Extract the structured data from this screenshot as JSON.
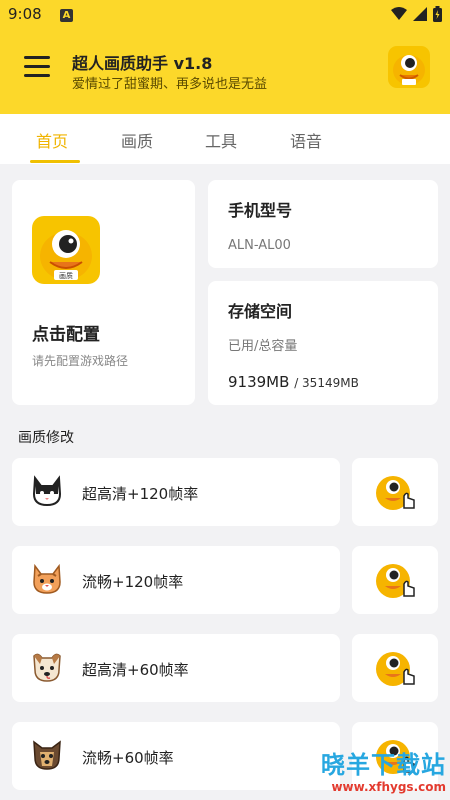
{
  "status": {
    "time": "9:08",
    "badge": "A"
  },
  "header": {
    "title": "超人画质助手 v1.8",
    "subtitle": "爱情过了甜蜜期、再多说也是无益"
  },
  "tabs": [
    {
      "label": "首页",
      "active": true
    },
    {
      "label": "画质"
    },
    {
      "label": "工具"
    },
    {
      "label": "语音"
    }
  ],
  "config": {
    "title": "点击配置",
    "subtitle": "请先配置游戏路径"
  },
  "model": {
    "title": "手机型号",
    "value": "ALN-AL00"
  },
  "storage": {
    "title": "存储空间",
    "label": "已用/总容量",
    "used": "9139MB",
    "total": "/ 35149MB"
  },
  "section_title": "画质修改",
  "options": [
    {
      "label": "超高清+120帧率",
      "icon": "cat-icon"
    },
    {
      "label": "流畅+120帧率",
      "icon": "cat-icon"
    },
    {
      "label": "超高清+60帧率",
      "icon": "dog-icon"
    },
    {
      "label": "流畅+60帧率",
      "icon": "dog-icon"
    }
  ],
  "watermark": {
    "main": "晓羊下载站",
    "url": "www.xfhygs.com"
  },
  "colors": {
    "accent": "#fcd82a",
    "tab_active": "#f0b400"
  }
}
